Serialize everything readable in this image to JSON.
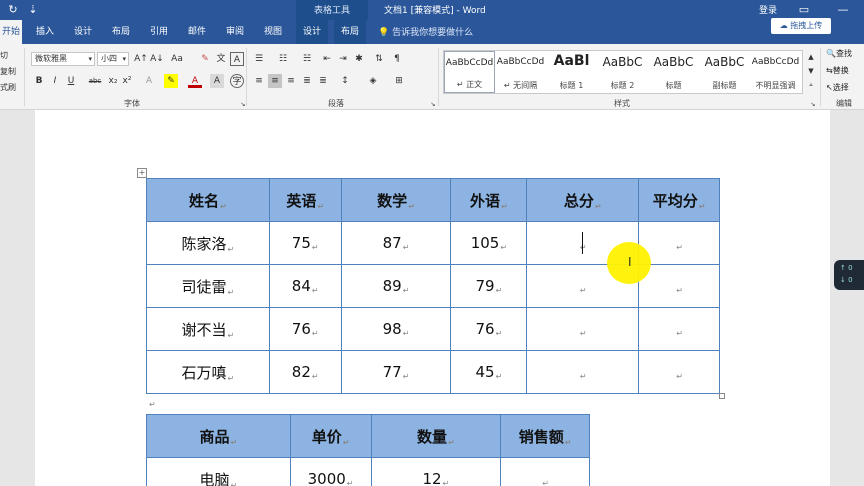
{
  "titlebar": {
    "context_group": "表格工具",
    "document_title": "文档1 [兼容模式] - Word",
    "login": "登录",
    "refresh_icon": "↻",
    "qat_icon": "⇣",
    "restore_icon": "▭",
    "minimize_icon": "—"
  },
  "tabs": [
    {
      "label": "开始",
      "active": true
    },
    {
      "label": "插入"
    },
    {
      "label": "设计"
    },
    {
      "label": "布局"
    },
    {
      "label": "引用"
    },
    {
      "label": "邮件"
    },
    {
      "label": "审阅"
    },
    {
      "label": "视图"
    },
    {
      "label": "设计"
    },
    {
      "label": "布局"
    }
  ],
  "tell_me": "告诉我你想要做什么",
  "share_button": "拖拽上传",
  "ribbon": {
    "clipboard": [
      "切",
      "复制",
      "式刷"
    ],
    "font_name": "微软雅黑",
    "font_size": "小四",
    "font_group_label": "字体",
    "paragraph_group_label": "段落",
    "styles_group_label": "样式",
    "editing_group_label": "编辑",
    "font_buttons_row2": [
      "B",
      "I",
      "U",
      "abc",
      "x₂",
      "x²"
    ],
    "font_buttons_row1": [
      "A↑",
      "A↓",
      "Aa",
      "✎",
      "文",
      "A"
    ],
    "styles": [
      {
        "preview": "AaBbCcDd",
        "label": "↵ 正文",
        "size": "small"
      },
      {
        "preview": "AaBbCcDd",
        "label": "↵ 无间隔",
        "size": "small"
      },
      {
        "preview": "AaBl",
        "label": "标题 1",
        "size": "big"
      },
      {
        "preview": "AaBbC",
        "label": "标题 2",
        "size": "mid"
      },
      {
        "preview": "AaBbC",
        "label": "标题",
        "size": "mid"
      },
      {
        "preview": "AaBbC",
        "label": "副标题",
        "size": "mid"
      },
      {
        "preview": "AaBbCcDd",
        "label": "不明显强调",
        "size": "small"
      }
    ],
    "editing": [
      "查找",
      "替换",
      "选择"
    ]
  },
  "table1": {
    "headers": [
      "姓名",
      "英语",
      "数学",
      "外语",
      "总分",
      "平均分"
    ],
    "rows": [
      [
        "陈家洛",
        "75",
        "87",
        "105",
        "",
        ""
      ],
      [
        "司徒雷",
        "84",
        "89",
        "79",
        "",
        ""
      ],
      [
        "谢不当",
        "76",
        "98",
        "76",
        "",
        ""
      ],
      [
        "石万嗔",
        "82",
        "77",
        "45",
        "",
        ""
      ]
    ]
  },
  "table2": {
    "headers": [
      "商品",
      "单价",
      "数量",
      "销售额"
    ],
    "rows": [
      [
        "电脑",
        "3000",
        "12",
        ""
      ]
    ]
  },
  "paragraph_mark": "↵",
  "float_panel": [
    "0",
    "0"
  ]
}
